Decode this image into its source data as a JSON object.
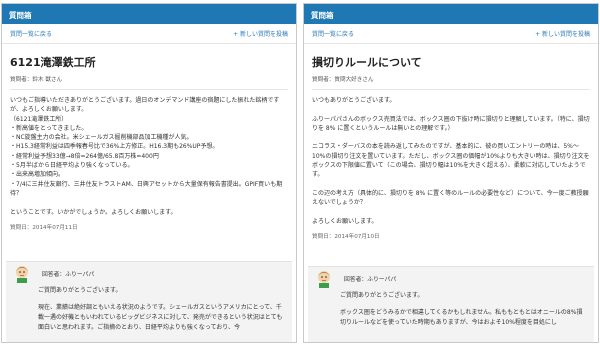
{
  "left": {
    "header": "質問箱",
    "nav_back": "質問一覧に戻る",
    "nav_new": "+ 新しい質問を投稿",
    "title": "6121滝澤鉄工所",
    "asker": "質問者：鈴木 獣さん",
    "body": [
      "いつもご指導いただきありがとうございます。過日のオンデマンド講座の宿題にした振れた銘柄ですが、よろしくお願いします。",
      "（6121滝澤鉄工所）",
      "・新高値をとってきました。",
      "・NC旋盤主力の会社。米シェールガス掘削機部品加工機種が人気。",
      "・H15.3経常利益は四季報春号比で36%上方修正。H16.3期も26%UP予想。",
      "・経常利益予想33億→8倍=264億/65.8百万株=400円",
      "・5月半ばから日経平均より強くなっている。",
      "・出来高増加傾向。",
      "・7/4に三井住友銀行、三井住友トラストAM、日興アセットから大量保有報告書提出。GPIF買いも期待？",
      "",
      "ということです。いかがでしょうか。よろしくお願いします。"
    ],
    "date": "質問日：2014年07月11日",
    "answer": {
      "name": "回答者：ふりーパパ",
      "body": [
        "ご質問ありがとうございます。",
        "現在、業績は絶好調ともいえる状況のようです。シェールガスというアメリカにとって、千載一遇の好機ともいわれているビッグビジネスに対して、発売ができるという状況はとても面白いと思われます。ご指摘のとおり、日経平均よりも強くなっており、今"
      ]
    }
  },
  "right": {
    "header": "質問箱",
    "nav_back": "質問一覧に戻る",
    "nav_new": "+ 新しい質問を投稿",
    "title": "損切りルールについて",
    "asker": "質問者：質問大好きさん",
    "body": [
      "いつもありがとうございます。",
      "",
      "ふりーパパさんのボックス売買法では、ボックス圏の下抜け時に損切りと理解しています。（特に、損切りを 8% に置くというルールは無いとの理解です。）",
      "",
      "ニコラス・ダーバスの本を読み返してみたのですが、基本的に、彼の買いエントリーの時は、5%〜10%の損切り注文を置いています。ただし、ボックス圏の価幅が10%よりも大きい時は、損切り注文をボックスの下限値に置いて（この場合、損切り幅は10%を大きく超える）、柔軟に対応していたようです。",
      "",
      "この辺の考え方（具体的に、損切りを 8% に置く等のルールの必要性など）について、今一度ご教授願えないでしょうか？",
      "",
      "よろしくお願いします。"
    ],
    "date": "質問日：2014年07月10日",
    "answer": {
      "name": "回答者：ふりーパパ",
      "body": [
        "ご質問ありがとうございます。",
        "ボックス圏をどうみるかで相違してくるかもしれません。私ももともとはオニールの8%損切りルールなどを使っていた時期もありますが、今はおよそ10%程度を目処にし"
      ]
    }
  }
}
